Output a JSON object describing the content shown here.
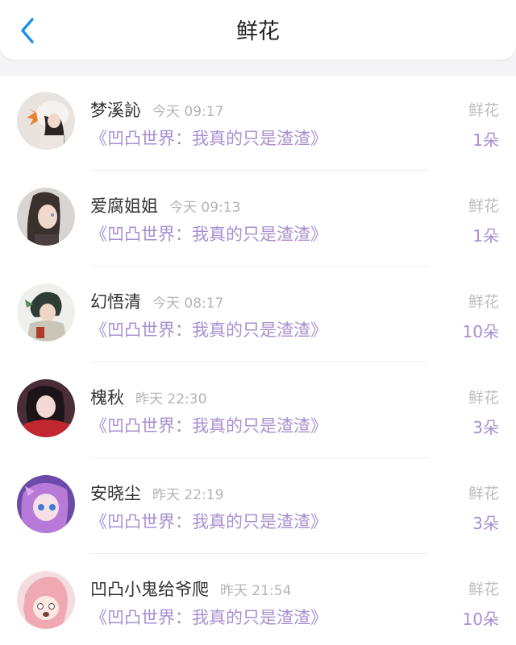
{
  "header": {
    "title": "鲜花",
    "back_icon": "chevron-left-icon",
    "accent_color": "#1e90e8"
  },
  "colors": {
    "book_title": "#a88fd0",
    "count": "#a88fd0",
    "time": "#b4b4b4",
    "type_label": "#bdbdbd"
  },
  "items": [
    {
      "name": "梦溪訫",
      "time": "今天 09:17",
      "book": "《凹凸世界：我真的只是渣渣》",
      "type": "鲜花",
      "count": "1朵"
    },
    {
      "name": "爱腐姐姐",
      "time": "今天 09:13",
      "book": "《凹凸世界：我真的只是渣渣》",
      "type": "鲜花",
      "count": "1朵"
    },
    {
      "name": "幻悟清",
      "time": "今天 08:17",
      "book": "《凹凸世界：我真的只是渣渣》",
      "type": "鲜花",
      "count": "10朵"
    },
    {
      "name": "槐秋",
      "time": "昨天 22:30",
      "book": "《凹凸世界：我真的只是渣渣》",
      "type": "鲜花",
      "count": "3朵"
    },
    {
      "name": "安晓尘",
      "time": "昨天 22:19",
      "book": "《凹凸世界：我真的只是渣渣》",
      "type": "鲜花",
      "count": "3朵"
    },
    {
      "name": "凹凸小鬼给爷爬",
      "time": "昨天 21:54",
      "book": "《凹凸世界：我真的只是渣渣》",
      "type": "鲜花",
      "count": "10朵"
    }
  ]
}
